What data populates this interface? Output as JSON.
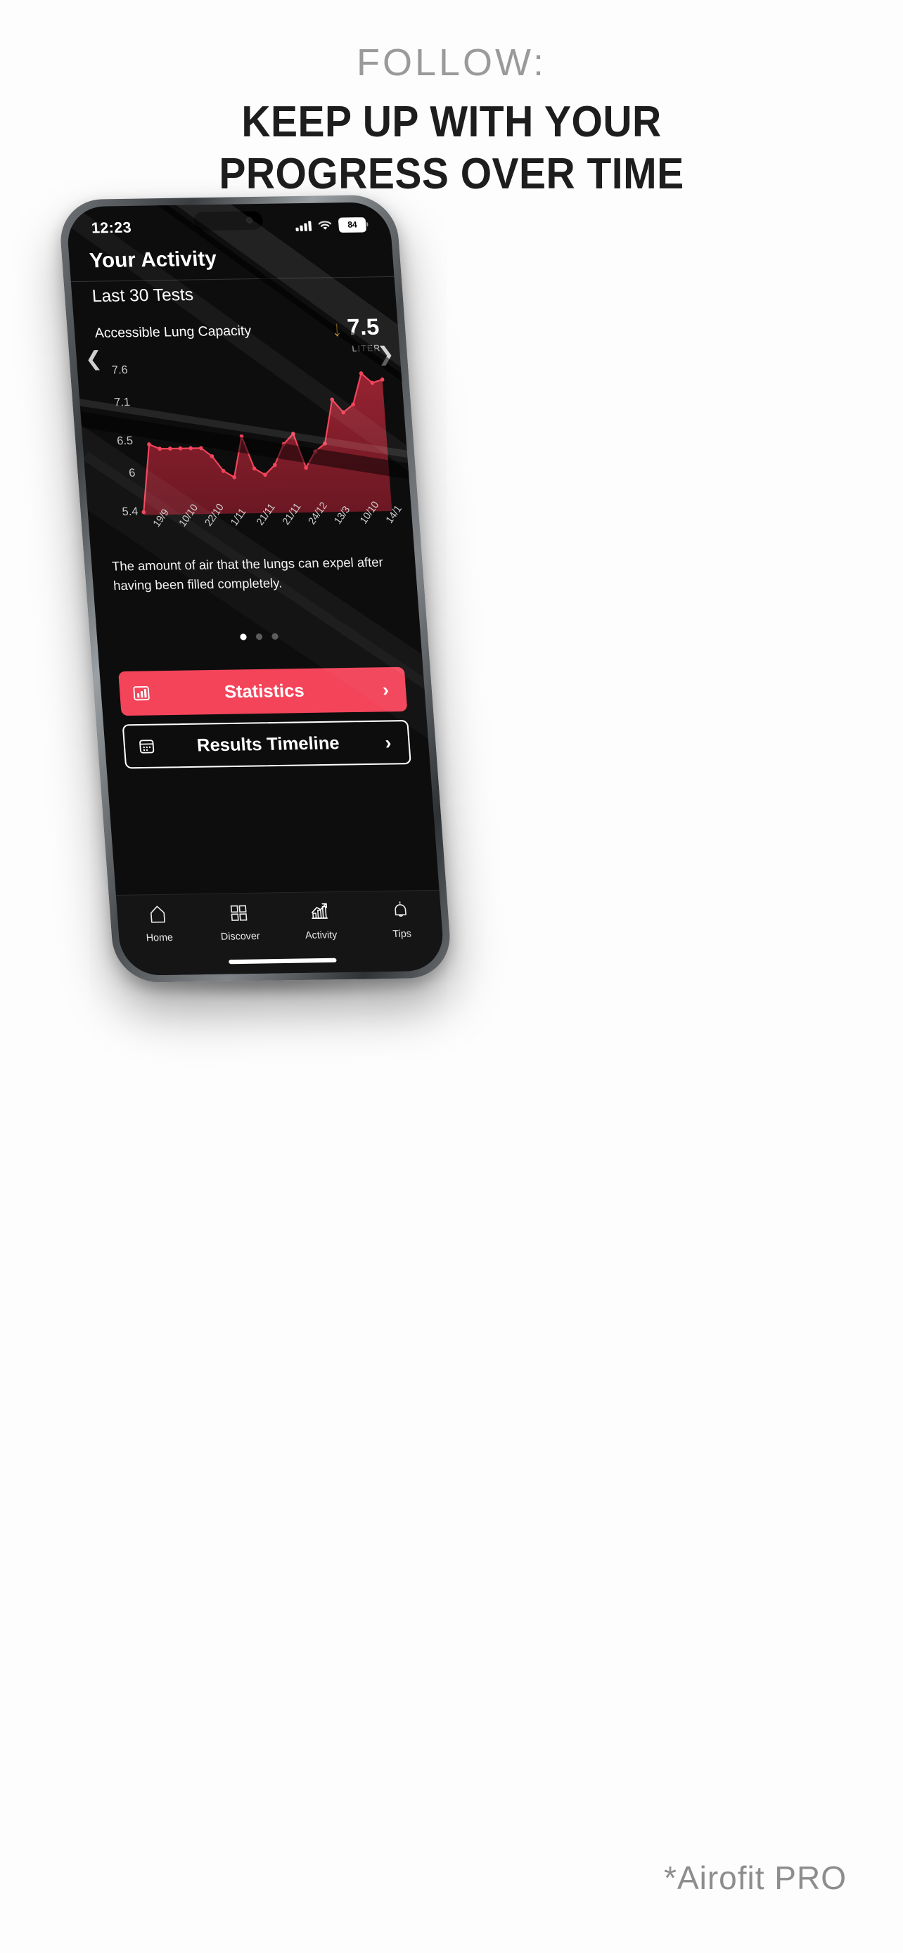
{
  "promo": {
    "eyebrow": "FOLLOW:",
    "headline_line1": "KEEP UP WITH YOUR",
    "headline_line2": "PROGRESS OVER TIME",
    "footnote": "*Airofit PRO",
    "eyebrow_color": "#9a9a9a",
    "headline_color": "#1d1d1d"
  },
  "status_bar": {
    "time": "12:23",
    "battery_level": "84",
    "signal_icon": "cellular-signal-icon",
    "wifi_icon": "wifi-icon",
    "battery_icon": "battery-icon"
  },
  "screen": {
    "page_title": "Your Activity",
    "subhead": "Last 30 Tests",
    "metric": {
      "name": "Accessible Lung Capacity",
      "trend_icon": "arrow-down-icon",
      "trend_color": "#F2B731",
      "value": "7.5",
      "unit": "LITER"
    },
    "description": "The amount of air that the lungs can expel after having been filled completely.",
    "carousel": {
      "total": 3,
      "active_index": 0
    },
    "nav_prev_icon": "chevron-left-icon",
    "nav_next_icon": "chevron-right-icon",
    "buttons": [
      {
        "label": "Statistics",
        "icon": "bar-chart-icon",
        "chevron": "›",
        "style": "primary",
        "color": "#F3445A"
      },
      {
        "label": "Results Timeline",
        "icon": "calendar-icon",
        "chevron": "›",
        "style": "outline"
      }
    ],
    "tabbar": [
      {
        "label": "Home",
        "icon": "home-icon",
        "active": false
      },
      {
        "label": "Discover",
        "icon": "grid-icon",
        "active": false
      },
      {
        "label": "Activity",
        "icon": "chart-growth-icon",
        "active": true
      },
      {
        "label": "Tips",
        "icon": "bell-icon",
        "active": false
      }
    ]
  },
  "chart_data": {
    "type": "area",
    "title": "Accessible Lung Capacity",
    "xlabel": "",
    "ylabel": "LITER",
    "ylim": [
      5.4,
      7.6
    ],
    "yticks": [
      "5.4",
      "6",
      "6.5",
      "7.1",
      "7.6"
    ],
    "ytick_values": [
      5.4,
      6.0,
      6.5,
      7.1,
      7.6
    ],
    "grid": false,
    "line_color": "#F3445A",
    "fill_color": "#8E1E2C",
    "categories": [
      "19/9",
      "10/10",
      "22/10",
      "1/11",
      "21/11",
      "21/11",
      "24/12",
      "13/3",
      "10/10",
      "14/1"
    ],
    "xtick_labels": [
      "19/9",
      "10/10",
      "22/10",
      "1/11",
      "21/11",
      "21/11",
      "24/12",
      "13/3",
      "10/10",
      "14/1"
    ],
    "values": [
      5.4,
      6.45,
      6.38,
      6.38,
      6.38,
      6.38,
      6.38,
      6.25,
      6.02,
      5.92,
      6.55,
      6.05,
      5.95,
      6.1,
      6.42,
      6.58,
      6.05,
      6.3,
      6.42,
      7.1,
      6.9,
      7.02,
      7.5,
      7.35,
      7.4
    ],
    "last_value": 7.5,
    "unit": "LITER",
    "series": [
      {
        "name": "Accessible Lung Capacity",
        "values": [
          5.4,
          6.45,
          6.38,
          6.38,
          6.38,
          6.38,
          6.38,
          6.25,
          6.02,
          5.92,
          6.55,
          6.05,
          5.95,
          6.1,
          6.42,
          6.58,
          6.05,
          6.3,
          6.42,
          7.1,
          6.9,
          7.02,
          7.5,
          7.35,
          7.4
        ]
      }
    ]
  }
}
